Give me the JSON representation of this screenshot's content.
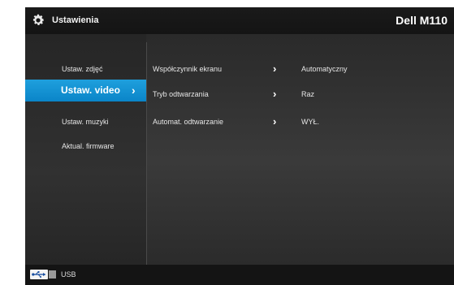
{
  "header": {
    "title": "Ustawienia",
    "model": "Dell M110",
    "icon": "gear-icon"
  },
  "sidebar": {
    "items": [
      {
        "label": "Ustaw. zdjęć",
        "active": false
      },
      {
        "label": "Ustaw. video",
        "active": true
      },
      {
        "label": "Ustaw. muzyki",
        "active": false
      },
      {
        "label": "Aktual. firmware",
        "active": false
      }
    ],
    "active_color": "#1a9ad8"
  },
  "settings": {
    "rows": [
      {
        "label": "Współczynnik ekranu",
        "value": "Automatyczny"
      },
      {
        "label": "Tryb odtwarzania",
        "value": "Raz"
      },
      {
        "label": "Automat. odtwarzanie",
        "value": "WYŁ."
      }
    ]
  },
  "footer": {
    "source_label": "USB",
    "icon": "usb-icon"
  }
}
